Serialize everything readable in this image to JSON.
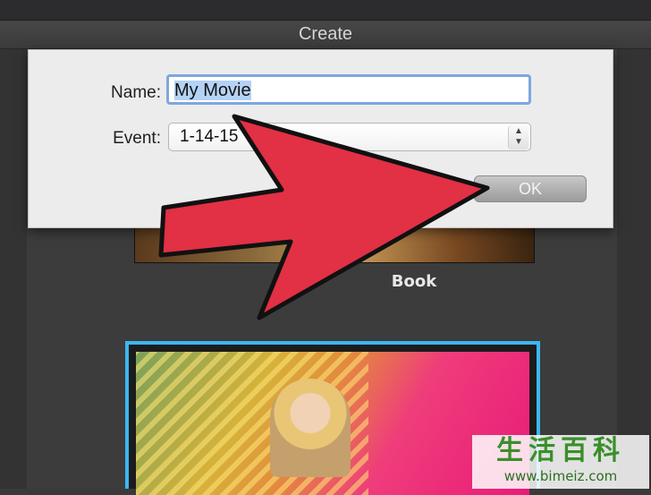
{
  "window": {
    "title": "Create"
  },
  "dialog": {
    "name_label": "Name:",
    "name_value": "My Movie",
    "event_label": "Event:",
    "event_value": "1-14-15",
    "ok_label": "OK"
  },
  "thumbnails": [
    {
      "label": "Book"
    }
  ],
  "watermark": {
    "text": "生活百科",
    "url": "www.bimeiz.com"
  },
  "colors": {
    "arrow": "#e23044",
    "selection_border": "#3db6f2",
    "focus_ring": "#7fa6e0"
  }
}
